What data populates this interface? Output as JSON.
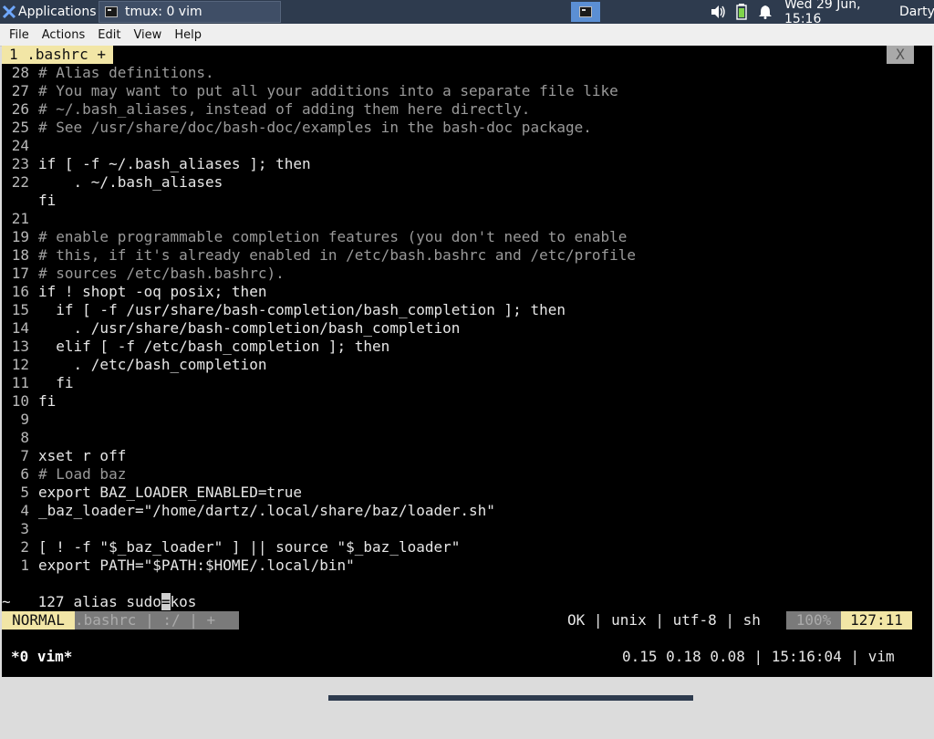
{
  "panel": {
    "apps_label": "Applications",
    "task_label": "tmux: 0 vim",
    "clock": "Wed 29 Jun, 15:16",
    "user": "Darty",
    "tray_icons": [
      "volume-icon",
      "battery-icon",
      "bell-icon"
    ]
  },
  "menubar": {
    "file": "File",
    "actions": "Actions",
    "edit": "Edit",
    "view": "View",
    "help": "Help"
  },
  "tabline": {
    "tab": "1 .bashrc +",
    "close": "X"
  },
  "lines": [
    {
      "n": "28",
      "t": "# Alias definitions."
    },
    {
      "n": "27",
      "t": "# You may want to put all your additions into a separate file like"
    },
    {
      "n": "26",
      "t": "# ~/.bash_aliases, instead of adding them here directly."
    },
    {
      "n": "25",
      "t": "# See /usr/share/doc/bash-doc/examples in the bash-doc package."
    },
    {
      "n": "24",
      "t": ""
    },
    {
      "n": "23",
      "t": "if [ -f ~/.bash_aliases ]; then"
    },
    {
      "n": "22",
      "t": "    . ~/.bash_aliases"
    },
    {
      "n": "",
      "t": "fi"
    },
    {
      "n": "21",
      "t": ""
    },
    {
      "n": "19",
      "t": "# enable programmable completion features (you don't need to enable"
    },
    {
      "n": "18",
      "t": "# this, if it's already enabled in /etc/bash.bashrc and /etc/profile"
    },
    {
      "n": "17",
      "t": "# sources /etc/bash.bashrc)."
    },
    {
      "n": "16",
      "t": "if ! shopt -oq posix; then"
    },
    {
      "n": "15",
      "t": "  if [ -f /usr/share/bash-completion/bash_completion ]; then"
    },
    {
      "n": "14",
      "t": "    . /usr/share/bash-completion/bash_completion"
    },
    {
      "n": "13",
      "t": "  elif [ -f /etc/bash_completion ]; then"
    },
    {
      "n": "12",
      "t": "    . /etc/bash_completion"
    },
    {
      "n": "11",
      "t": "  fi"
    },
    {
      "n": "10",
      "t": "fi"
    },
    {
      "n": "9",
      "t": ""
    },
    {
      "n": "8",
      "t": ""
    },
    {
      "n": "7",
      "t": "xset r off"
    },
    {
      "n": "6",
      "t": "# Load baz"
    },
    {
      "n": "5",
      "t": "export BAZ_LOADER_ENABLED=true"
    },
    {
      "n": "4",
      "t": "_baz_loader=\"/home/dartz/.local/share/baz/loader.sh\""
    },
    {
      "n": "3",
      "t": ""
    },
    {
      "n": "2",
      "t": "[ ! -f \"$_baz_loader\" ] || source \"$_baz_loader\""
    },
    {
      "n": "1",
      "t": "export PATH=\"$PATH:$HOME/.local/bin\""
    }
  ],
  "current_line": {
    "n": "127",
    "before": "alias sudo",
    "cursor": "=",
    "after": "kos"
  },
  "tilde": "~",
  "statusline": {
    "mode": "NORMAL",
    "file": ".bashrc | :/ | +",
    "right": "OK | unix | utf-8 | sh",
    "percent": "100%",
    "position": "127:11"
  },
  "tmux": {
    "window": "*0 vim*",
    "right": "0.15 0.18 0.08 | 15:16:04 | vim"
  }
}
